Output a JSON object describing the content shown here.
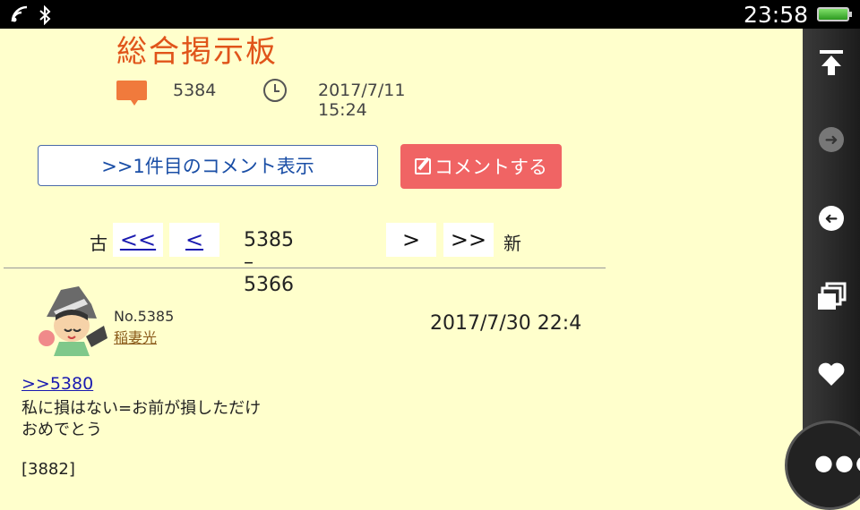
{
  "status_bar": {
    "wifi_icon": "wifi-icon",
    "bluetooth_icon": "bluetooth-icon",
    "time": "23:58",
    "battery_icon": "battery-icon"
  },
  "board": {
    "title": "総合掲示板",
    "comment_count": "5384",
    "created": "2017/7/11 15:24"
  },
  "buttons": {
    "show_first": ">>1件目のコメント表示",
    "comment": "コメントする"
  },
  "pager": {
    "old_label": "古",
    "first": "<<",
    "prev": "<",
    "range": "5385 – 5366",
    "next": ">",
    "last": ">>",
    "new_label": "新"
  },
  "post": {
    "number": "No.5385",
    "name": "稲妻光",
    "date": "2017/7/30 22:4",
    "reply_to": ">>5380",
    "lines": [
      "私に損はない=お前が損しただけ",
      "おめでとう",
      "[3882]"
    ]
  },
  "sidebar": {
    "items": [
      "scroll-top-icon",
      "forward-icon",
      "back-icon",
      "tabs-icon",
      "favorite-icon"
    ],
    "more_icon": "more-icon"
  },
  "colors": {
    "background": "#ffffcc",
    "title": "#e0541a",
    "comment_button": "#f06464",
    "link": "#1a1ab0"
  }
}
